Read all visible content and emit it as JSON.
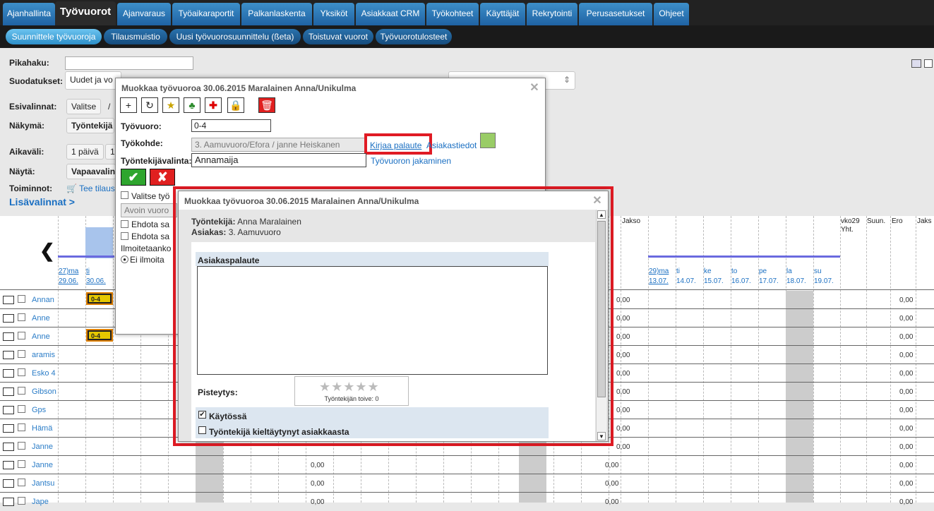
{
  "topnav": {
    "tabs": [
      "Ajanhallinta",
      "Työvuorot",
      "Ajanvaraus",
      "Työaikaraportit",
      "Palkanlaskenta",
      "Yksiköt",
      "Asiakkaat CRM",
      "Työkohteet",
      "Käyttäjät",
      "Rekrytointi",
      "Perusasetukset",
      "Ohjeet"
    ]
  },
  "subnav": {
    "items": [
      "Suunnittele työvuoroja",
      "Tilausmuistio",
      "Uusi työvuorosuunnittelu (ßeta)",
      "Toistuvat vuorot",
      "Työvuorotulosteet"
    ]
  },
  "filters": {
    "pikahaku_label": "Pikahaku:",
    "suodatukset_label": "Suodatukset:",
    "suodatukset_value": "Uudet ja vo",
    "esivalinnat_label": "Esivalinnat:",
    "valitse_button": "Valitse",
    "slash": "/",
    "nakyma_label": "Näkymä:",
    "nakyma_value": "Työntekijä",
    "aikavali_label": "Aikaväli:",
    "aikavali_value": "1 päivä",
    "aikavali_value2": "1",
    "nayta_label": "Näytä:",
    "nayta_value": "Vapaavalint",
    "toiminnot_label": "Toiminnot:",
    "tee_tilaus": "Tee tilaus",
    "lisavalinnat": "Lisävalinnat >"
  },
  "grid": {
    "prev_arrow": "❮",
    "date_left_1": "27)ma",
    "date_left_1b": "29.06.",
    "date_left_2": "ti",
    "date_left_2b": "30.06.",
    "date_right": [
      "29)ma",
      "ti",
      "ke",
      "to",
      "pe",
      "la",
      "su"
    ],
    "date_right_b": [
      "13.07.",
      "14.07.",
      "15.07.",
      "16.07.",
      "17.07.",
      "18.07.",
      "19.07."
    ],
    "jakso1": "Jakso",
    "vko29": "vko29",
    "yht": "Yht.",
    "suun": "Suun.",
    "ero": "Ero",
    "jakso2": "Jaks",
    "rows": [
      "Annan",
      "Anne",
      "Anne",
      "aramis",
      "Esko 4",
      "Gibson",
      "Gps",
      "Hämä",
      "Janne",
      "Janne",
      "Jantsu",
      "Jape"
    ],
    "zero_val": "0,00",
    "shift_label": "0-4"
  },
  "dialog1": {
    "title": "Muokkaa työvuoroa 30.06.2015 Maralainen Anna/Unikulma",
    "tyovuoro_label": "Työvuoro:",
    "tyovuoro_value": "0-4",
    "tyokohde_label": "Työkohde:",
    "tyokohde_value": "3. Aamuvuoro/Efora / janne Heiskanen",
    "kirjaa_palaute": "Kirjaa palaute",
    "asiakastiedot": "Asiakastiedot",
    "tyontekijavalinta_label": "Työntekijävalinta:",
    "tyontekijavalinta_value": "Annamaija",
    "jakaminen": "Työvuoron jakaminen",
    "valitse_tyo": "Valitse työ",
    "avoin_vuoro": "Avoin vuoro",
    "ehdota1": "Ehdota sa",
    "ehdota2": "Ehdota sa",
    "ilmoitetaanko": "Ilmoitetaanko",
    "ei_ilmoiteta": "Ei ilmoita"
  },
  "dialog2": {
    "title": "Muokkaa työvuoroa 30.06.2015 Maralainen Anna/Unikulma",
    "tyontekija_label": "Työntekijä:",
    "tyontekija_value": "Anna Maralainen",
    "asiakas_label": "Asiakas:",
    "asiakas_value": "3. Aamuvuoro",
    "asiakaspalaute": "Asiakaspalaute",
    "pisteytys": "Pisteytys:",
    "toive": "Työntekijän toive: 0",
    "kaytossa": "Käytössä",
    "kieltaytynyt": "Työntekijä kieltäytynyt asiakkaasta"
  },
  "colors": {
    "highlight_red": "#e01b24",
    "tab_blue": "#2a78b8",
    "shift_yellow": "#e6c800"
  }
}
